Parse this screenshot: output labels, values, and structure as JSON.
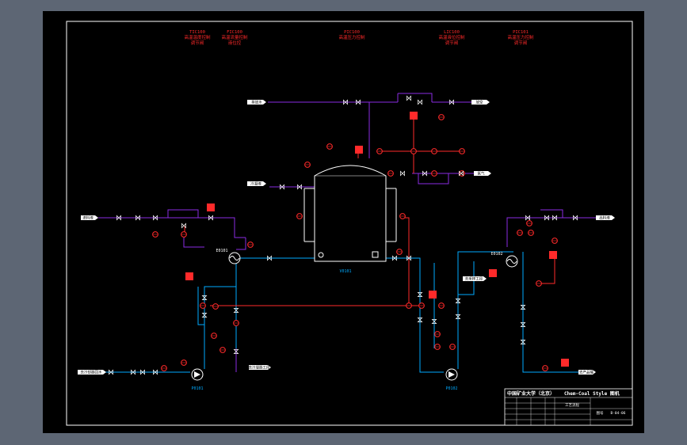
{
  "title_block": {
    "school": "中国矿业大学（北京）",
    "style": "Chem-Coal Style 图机",
    "drawing_name": "工艺流程",
    "drawing_no_label": "图号",
    "drawing_no": "B-04-06"
  },
  "top_tags": [
    {
      "id": "TIC100",
      "line1": "高温温度控制",
      "line2": "调节阀"
    },
    {
      "id": "FIC100",
      "line1": "高温流量控制",
      "line2": "液位控"
    },
    {
      "id": "PIC100",
      "line1": "高温压力控制",
      "line2": ""
    },
    {
      "id": "LIC100",
      "line1": "高温液位控制",
      "line2": "调节阀"
    },
    {
      "id": "PIC101",
      "line1": "高温压力控制",
      "line2": "调节阀"
    }
  ],
  "streams": {
    "top_left": "排放水",
    "mid_left": "冷凝液",
    "left_in": "进料液",
    "vent": "放空",
    "gas_in": "氮气",
    "right_out": "出料液",
    "bottom_left_in": "去冷却器回水",
    "bottom_center_out": "去冷凝器工段",
    "side_out": "去采样工段",
    "bottom_right_out": "去产品罐"
  },
  "equipment": {
    "tank": "V0101",
    "hx_left": "E0101",
    "hx_right": "E0102",
    "pump_left": "P0101",
    "pump_mid": "P0102"
  },
  "colors": {
    "background": "#000000",
    "process_line": "#00aaff",
    "utility_line": "#8a2be2",
    "control": "#ff2a2a",
    "equipment": "#ffffff",
    "border": "#ffffff"
  }
}
